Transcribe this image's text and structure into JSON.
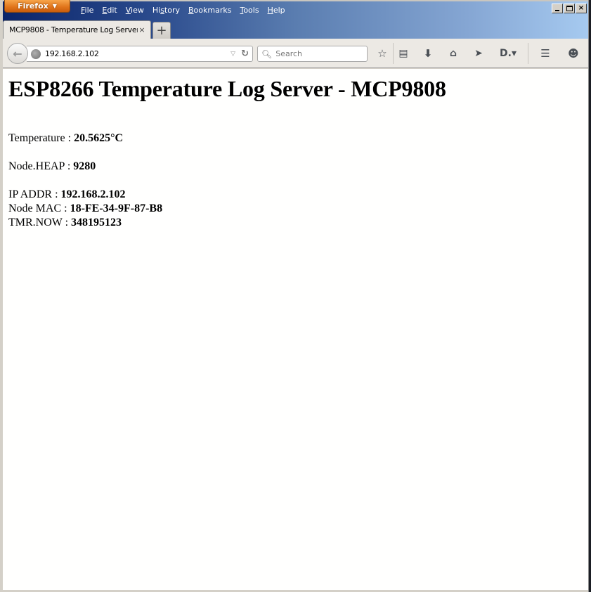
{
  "window": {
    "app_button": "Firefox",
    "menu": [
      "File",
      "Edit",
      "View",
      "History",
      "Bookmarks",
      "Tools",
      "Help"
    ],
    "menu_accel": [
      "F",
      "E",
      "V",
      "s",
      "B",
      "T",
      "H"
    ],
    "controls": {
      "minimize": "minimize-icon",
      "maximize": "maximize-icon",
      "close": "×"
    }
  },
  "tabs": [
    {
      "title": "MCP9808 - Temperature Log Server...",
      "close": "×",
      "active": true
    }
  ],
  "new_tab_label": "+",
  "navbar": {
    "url": "192.168.2.102",
    "search_placeholder": "Search",
    "icons": [
      "back-arrow-icon",
      "globe-icon",
      "dropdown-icon",
      "reload-icon",
      "search-icon",
      "bookmark-star-icon",
      "reading-list-icon",
      "download-icon",
      "home-icon",
      "send-icon",
      "pocket-icon",
      "hamburger-menu-icon",
      "chat-icon"
    ]
  },
  "page": {
    "title": "ESP8266 Temperature Log Server - MCP9808",
    "temperature": {
      "label": "Temperature : ",
      "value": "20.5625°C"
    },
    "heap": {
      "label": "Node.HEAP : ",
      "value": "9280"
    },
    "ip": {
      "label": "IP ADDR : ",
      "value": "192.168.2.102"
    },
    "mac": {
      "label": "Node MAC : ",
      "value": "18-FE-34-9F-87-B8"
    },
    "tmr": {
      "label": "TMR.NOW : ",
      "value": "348195123"
    }
  }
}
